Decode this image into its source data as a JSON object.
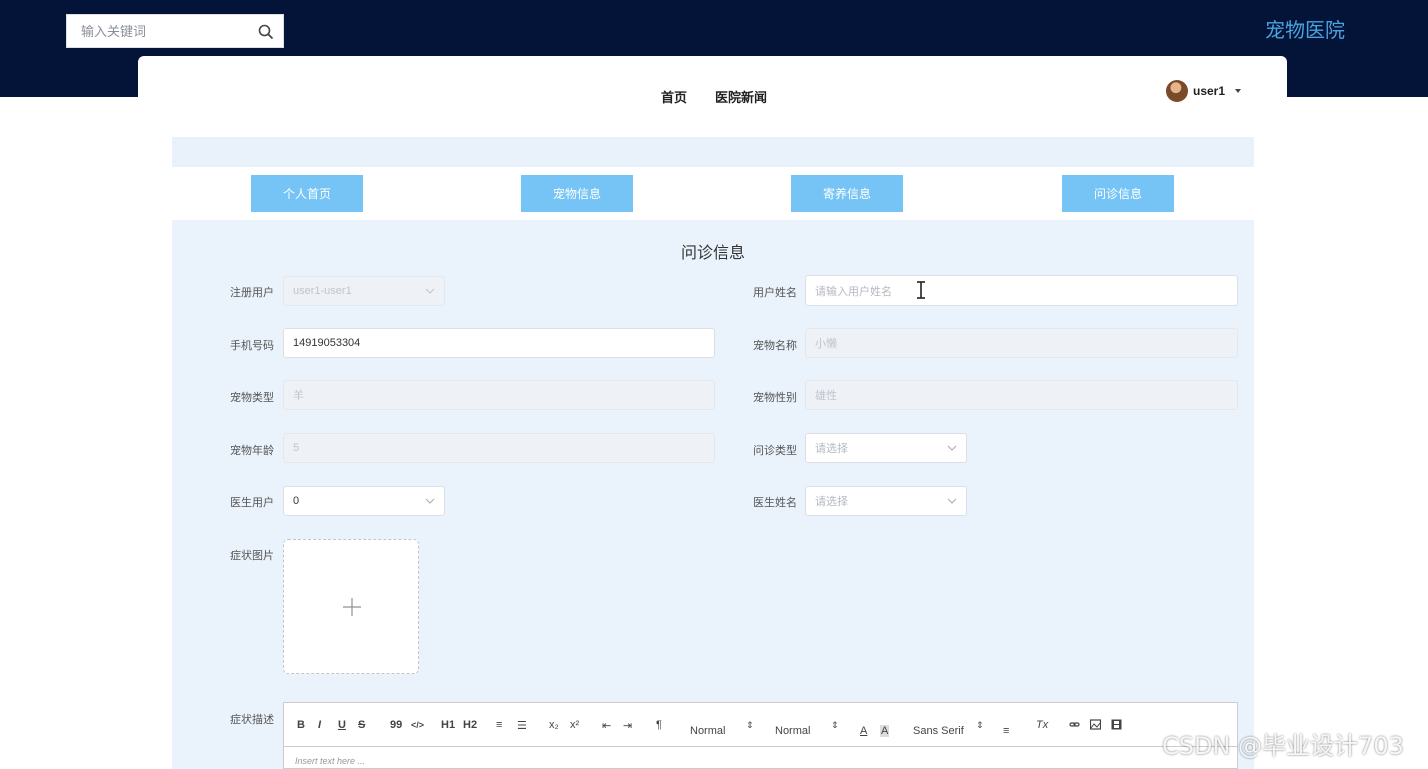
{
  "header": {
    "search_placeholder": "输入关键词",
    "brand": "宠物医院",
    "colors": {
      "topbar": "#031438",
      "brand": "#4aa3df",
      "tab": "#76c4f5",
      "panel": "#eaf3fc"
    }
  },
  "nav": {
    "links": [
      "首页",
      "医院新闻"
    ],
    "user": "user1"
  },
  "tabs": [
    "个人首页",
    "宠物信息",
    "寄养信息",
    "问诊信息"
  ],
  "form": {
    "title": "问诊信息",
    "fields": {
      "reg_user": {
        "label": "注册用户",
        "value": "user1-user1"
      },
      "user_name": {
        "label": "用户姓名",
        "placeholder": "请输入用户姓名"
      },
      "phone": {
        "label": "手机号码",
        "value": "14919053304"
      },
      "pet_name": {
        "label": "宠物名称",
        "value": "小懒"
      },
      "pet_type": {
        "label": "宠物类型",
        "value": "羊"
      },
      "pet_gender": {
        "label": "宠物性别",
        "value": "雄性"
      },
      "pet_age": {
        "label": "宠物年龄",
        "value": "5"
      },
      "consult_type": {
        "label": "问诊类型",
        "placeholder": "请选择"
      },
      "doctor_user": {
        "label": "医生用户",
        "value": "0"
      },
      "doctor_name": {
        "label": "医生姓名",
        "placeholder": "请选择"
      },
      "symptom_image": {
        "label": "症状图片"
      },
      "symptom_desc": {
        "label": "症状描述"
      }
    },
    "editor": {
      "placeholder": "Insert text here ...",
      "toolbar": {
        "bold": "B",
        "italic": "I",
        "underline": "U",
        "strike": "S",
        "blockquote": "99",
        "code": "</>",
        "h1": "H1",
        "h2": "H2",
        "ordered_list": "≡",
        "bullet_list": "☰",
        "subscript": "x₂",
        "superscript": "x²",
        "outdent": "⇤",
        "indent": "⇥",
        "direction": "¶",
        "size": "Normal",
        "header": "Normal",
        "color": "A",
        "background": "A",
        "font": "Sans Serif",
        "align": "≡",
        "clean": "Tx"
      }
    }
  },
  "watermark": "CSDN @毕业设计703"
}
